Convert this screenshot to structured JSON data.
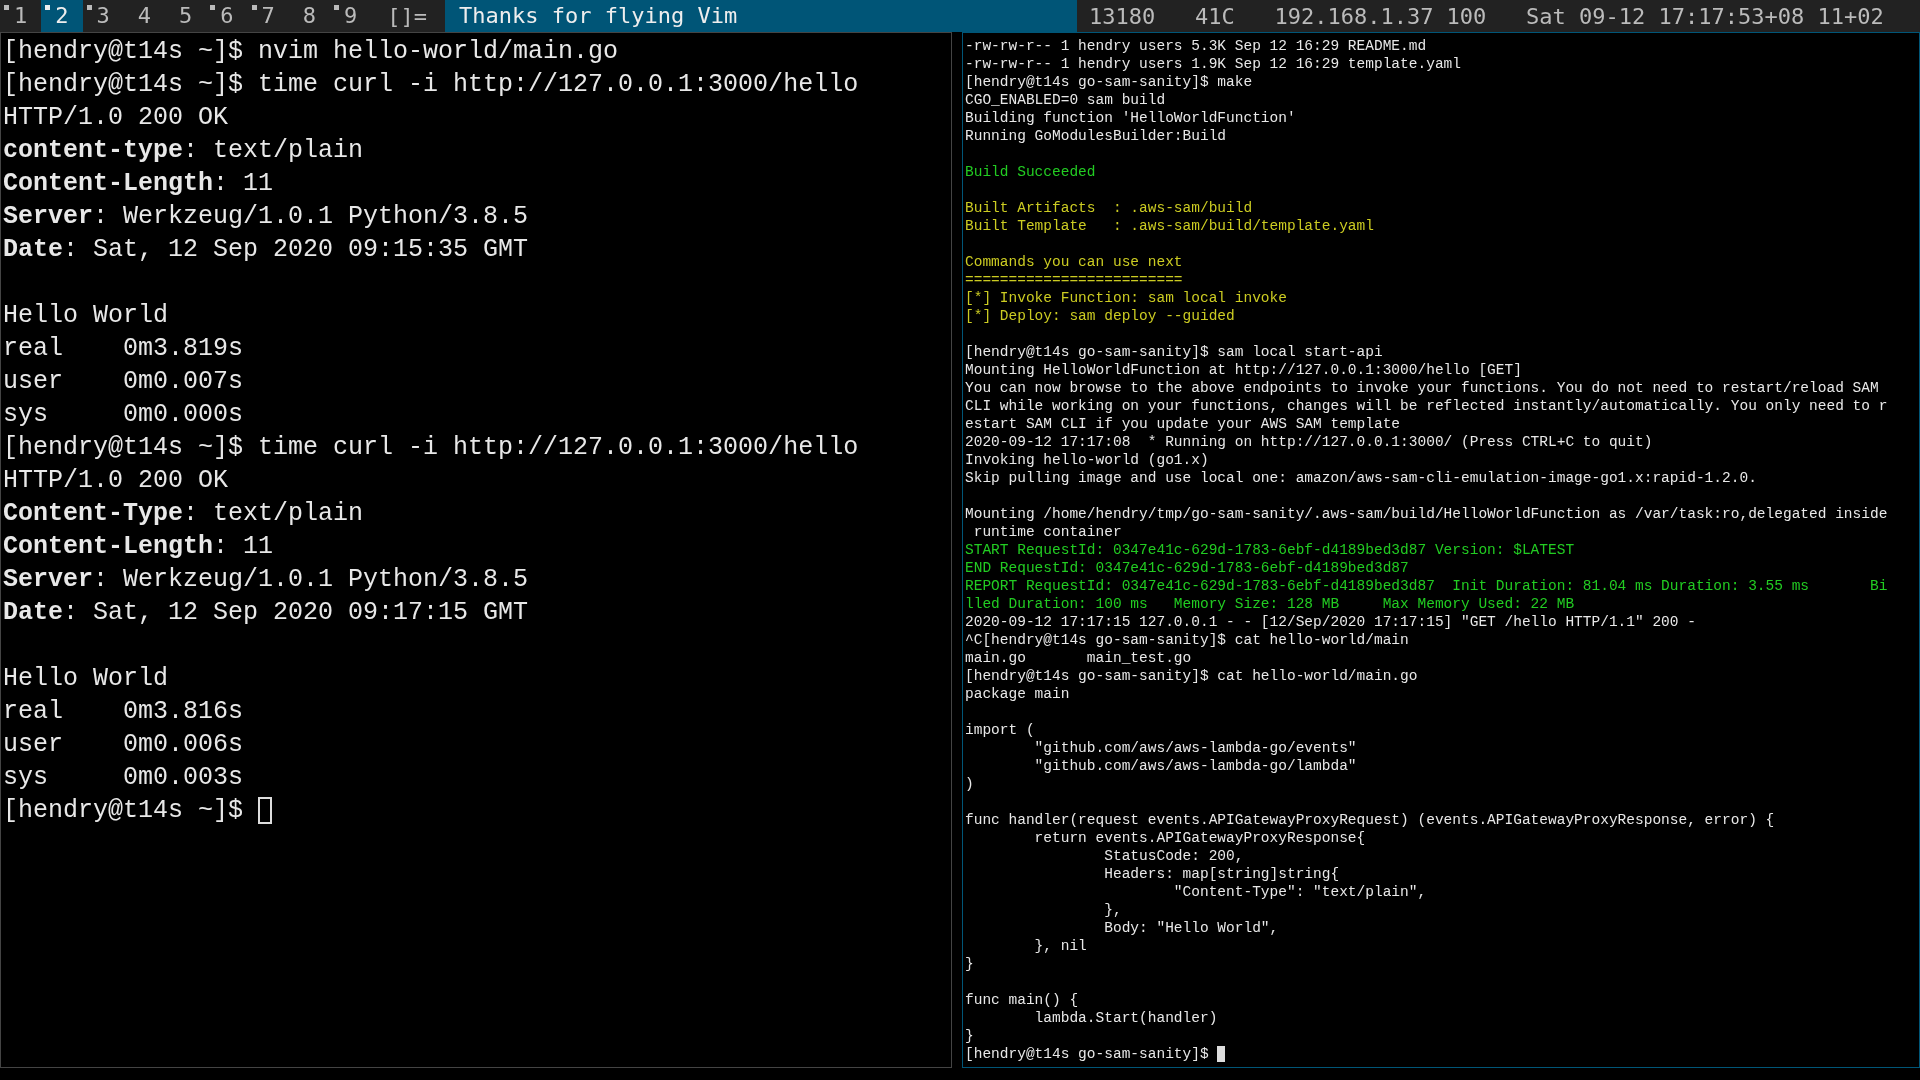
{
  "bar": {
    "tags": [
      {
        "label": "1",
        "selected": false,
        "occupied": true
      },
      {
        "label": "2",
        "selected": true,
        "occupied": true
      },
      {
        "label": "3",
        "selected": false,
        "occupied": true
      },
      {
        "label": "4",
        "selected": false,
        "occupied": false
      },
      {
        "label": "5",
        "selected": false,
        "occupied": false
      },
      {
        "label": "6",
        "selected": false,
        "occupied": true
      },
      {
        "label": "7",
        "selected": false,
        "occupied": true
      },
      {
        "label": "8",
        "selected": false,
        "occupied": false
      },
      {
        "label": "9",
        "selected": false,
        "occupied": true
      }
    ],
    "layout": "[]=",
    "title": "Thanks for flying Vim",
    "status": "13180   41C   192.168.1.37 100   Sat 09-12 17:17:53+08 11+02"
  },
  "panes": [
    {
      "focused": false,
      "lines": [
        {
          "kind": "output",
          "text": "[hendry@t14s ~]$ nvim hello-world/main.go"
        },
        {
          "kind": "output",
          "text": "[hendry@t14s ~]$ time curl -i http://127.0.0.1:3000/hello"
        },
        {
          "kind": "output",
          "text": "HTTP/1.0 200 OK"
        },
        {
          "kind": "output",
          "text": "**content-type**: text/plain"
        },
        {
          "kind": "output",
          "text": "**Content-Length**: 11"
        },
        {
          "kind": "output",
          "text": "**Server**: Werkzeug/1.0.1 Python/3.8.5"
        },
        {
          "kind": "output",
          "text": "**Date**: Sat, 12 Sep 2020 09:15:35 GMT"
        },
        {
          "kind": "blank"
        },
        {
          "kind": "output",
          "text": "Hello World"
        },
        {
          "kind": "output",
          "text": "real    0m3.819s"
        },
        {
          "kind": "output",
          "text": "user    0m0.007s"
        },
        {
          "kind": "output",
          "text": "sys     0m0.000s"
        },
        {
          "kind": "output",
          "text": "[hendry@t14s ~]$ time curl -i http://127.0.0.1:3000/hello"
        },
        {
          "kind": "output",
          "text": "HTTP/1.0 200 OK"
        },
        {
          "kind": "output",
          "text": "**Content-Type**: text/plain"
        },
        {
          "kind": "output",
          "text": "**Content-Length**: 11"
        },
        {
          "kind": "output",
          "text": "**Server**: Werkzeug/1.0.1 Python/3.8.5"
        },
        {
          "kind": "output",
          "text": "**Date**: Sat, 12 Sep 2020 09:17:15 GMT"
        },
        {
          "kind": "blank"
        },
        {
          "kind": "output",
          "text": "Hello World"
        },
        {
          "kind": "output",
          "text": "real    0m3.816s"
        },
        {
          "kind": "output",
          "text": "user    0m0.006s"
        },
        {
          "kind": "output",
          "text": "sys     0m0.003s"
        }
      ],
      "prompt": "[hendry@t14s ~]$"
    },
    {
      "focused": true,
      "lines": [
        {
          "kind": "output",
          "text": "-rw-rw-r-- 1 hendry users 5.3K Sep 12 16:29 README.md"
        },
        {
          "kind": "output",
          "text": "-rw-rw-r-- 1 hendry users 1.9K Sep 12 16:29 template.yaml"
        },
        {
          "kind": "output",
          "text": "[hendry@t14s go-sam-sanity]$ make"
        },
        {
          "kind": "output",
          "text": "CGO_ENABLED=0 sam build"
        },
        {
          "kind": "output",
          "text": "Building function 'HelloWorldFunction'"
        },
        {
          "kind": "output",
          "text": "Running GoModulesBuilder:Build"
        },
        {
          "kind": "blank"
        },
        {
          "kind": "success",
          "text": "Build Succeeded"
        },
        {
          "kind": "blank"
        },
        {
          "kind": "notice",
          "text": "Built Artifacts  : .aws-sam/build"
        },
        {
          "kind": "notice",
          "text": "Built Template   : .aws-sam/build/template.yaml"
        },
        {
          "kind": "blank"
        },
        {
          "kind": "notice",
          "text": "Commands you can use next"
        },
        {
          "kind": "notice",
          "text": "========================="
        },
        {
          "kind": "notice",
          "text": "[*] Invoke Function: sam local invoke"
        },
        {
          "kind": "notice",
          "text": "[*] Deploy: sam deploy --guided"
        },
        {
          "kind": "blank"
        },
        {
          "kind": "output",
          "text": "[hendry@t14s go-sam-sanity]$ sam local start-api"
        },
        {
          "kind": "output",
          "text": "Mounting HelloWorldFunction at http://127.0.0.1:3000/hello [GET]"
        },
        {
          "kind": "output",
          "text": "You can now browse to the above endpoints to invoke your functions. You do not need to restart/reload SAM"
        },
        {
          "kind": "output",
          "text": "CLI while working on your functions, changes will be reflected instantly/automatically. You only need to r"
        },
        {
          "kind": "output",
          "text": "estart SAM CLI if you update your AWS SAM template"
        },
        {
          "kind": "output",
          "text": "2020-09-12 17:17:08  * Running on http://127.0.0.1:3000/ (Press CTRL+C to quit)"
        },
        {
          "kind": "output",
          "text": "Invoking hello-world (go1.x)"
        },
        {
          "kind": "output",
          "text": "Skip pulling image and use local one: amazon/aws-sam-cli-emulation-image-go1.x:rapid-1.2.0."
        },
        {
          "kind": "blank"
        },
        {
          "kind": "output",
          "text": "Mounting /home/hendry/tmp/go-sam-sanity/.aws-sam/build/HelloWorldFunction as /var/task:ro,delegated inside"
        },
        {
          "kind": "output",
          "text": " runtime container"
        },
        {
          "kind": "success",
          "text": "START RequestId: 0347e41c-629d-1783-6ebf-d4189bed3d87 Version: $LATEST"
        },
        {
          "kind": "success",
          "text": "END RequestId: 0347e41c-629d-1783-6ebf-d4189bed3d87"
        },
        {
          "kind": "success",
          "text": "REPORT RequestId: 0347e41c-629d-1783-6ebf-d4189bed3d87  Init Duration: 81.04 ms Duration: 3.55 ms       Bi"
        },
        {
          "kind": "success",
          "text": "lled Duration: 100 ms   Memory Size: 128 MB     Max Memory Used: 22 MB"
        },
        {
          "kind": "output",
          "text": "2020-09-12 17:17:15 127.0.0.1 - - [12/Sep/2020 17:17:15] \"GET /hello HTTP/1.1\" 200 -"
        },
        {
          "kind": "output",
          "text": "^C[hendry@t14s go-sam-sanity]$ cat hello-world/main"
        },
        {
          "kind": "output",
          "text": "main.go       main_test.go"
        },
        {
          "kind": "output",
          "text": "[hendry@t14s go-sam-sanity]$ cat hello-world/main.go"
        },
        {
          "kind": "output",
          "text": "package main"
        },
        {
          "kind": "blank"
        },
        {
          "kind": "output",
          "text": "import ("
        },
        {
          "kind": "output",
          "text": "        \"github.com/aws/aws-lambda-go/events\""
        },
        {
          "kind": "output",
          "text": "        \"github.com/aws/aws-lambda-go/lambda\""
        },
        {
          "kind": "output",
          "text": ")"
        },
        {
          "kind": "blank"
        },
        {
          "kind": "output",
          "text": "func handler(request events.APIGatewayProxyRequest) (events.APIGatewayProxyResponse, error) {"
        },
        {
          "kind": "output",
          "text": "        return events.APIGatewayProxyResponse{"
        },
        {
          "kind": "output",
          "text": "                StatusCode: 200,"
        },
        {
          "kind": "output",
          "text": "                Headers: map[string]string{"
        },
        {
          "kind": "output",
          "text": "                        \"Content-Type\": \"text/plain\","
        },
        {
          "kind": "output",
          "text": "                },"
        },
        {
          "kind": "output",
          "text": "                Body: \"Hello World\","
        },
        {
          "kind": "output",
          "text": "        }, nil"
        },
        {
          "kind": "output",
          "text": "}"
        },
        {
          "kind": "blank"
        },
        {
          "kind": "output",
          "text": "func main() {"
        },
        {
          "kind": "output",
          "text": "        lambda.Start(handler)"
        },
        {
          "kind": "output",
          "text": "}"
        }
      ],
      "prompt": "[hendry@t14s go-sam-sanity]$"
    }
  ]
}
